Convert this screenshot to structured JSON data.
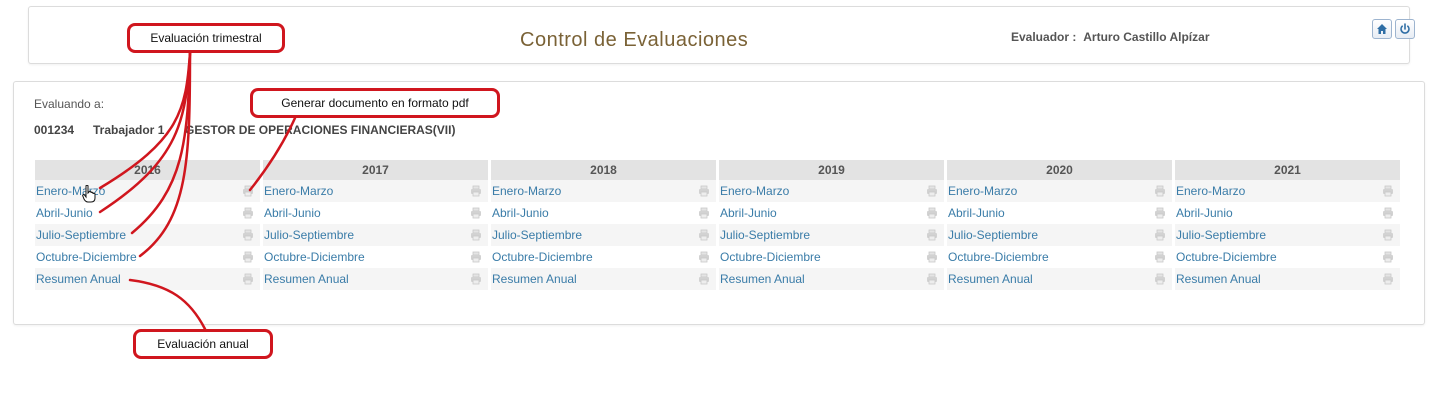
{
  "header": {
    "title": "Control de Evaluaciones",
    "evaluator_label": "Evaluador :",
    "evaluator_name": "Arturo Castillo Alpízar",
    "home_icon": "home-icon",
    "power_icon": "power-icon"
  },
  "main": {
    "evaluating_label": "Evaluando a:",
    "worker": {
      "id": "001234",
      "name": "Trabajador 1",
      "position": "GESTOR DE OPERACIONES FINANCIERAS(VII)"
    },
    "years": [
      {
        "year": "2016",
        "items": [
          "Enero-Marzo",
          "Abril-Junio",
          "Julio-Septiembre",
          "Octubre-Diciembre",
          "Resumen Anual"
        ]
      },
      {
        "year": "2017",
        "items": [
          "Enero-Marzo",
          "Abril-Junio",
          "Julio-Septiembre",
          "Octubre-Diciembre",
          "Resumen Anual"
        ]
      },
      {
        "year": "2018",
        "items": [
          "Enero-Marzo",
          "Abril-Junio",
          "Julio-Septiembre",
          "Octubre-Diciembre",
          "Resumen Anual"
        ]
      },
      {
        "year": "2019",
        "items": [
          "Enero-Marzo",
          "Abril-Junio",
          "Julio-Septiembre",
          "Octubre-Diciembre",
          "Resumen Anual"
        ]
      },
      {
        "year": "2020",
        "items": [
          "Enero-Marzo",
          "Abril-Junio",
          "Julio-Septiembre",
          "Octubre-Diciembre",
          "Resumen Anual"
        ]
      },
      {
        "year": "2021",
        "items": [
          "Enero-Marzo",
          "Abril-Junio",
          "Julio-Septiembre",
          "Octubre-Diciembre",
          "Resumen Anual"
        ]
      }
    ],
    "pdf_icon": "printer-icon"
  },
  "annotations": {
    "quarterly": "Evaluación trimestral",
    "pdf": "Generar documento en formato pdf",
    "annual": "Evaluación anual"
  },
  "colors": {
    "title": "#7a6236",
    "link": "#3a7ca8",
    "callout_border": "#d0161e",
    "year_header_bg": "#e3e3e3"
  }
}
